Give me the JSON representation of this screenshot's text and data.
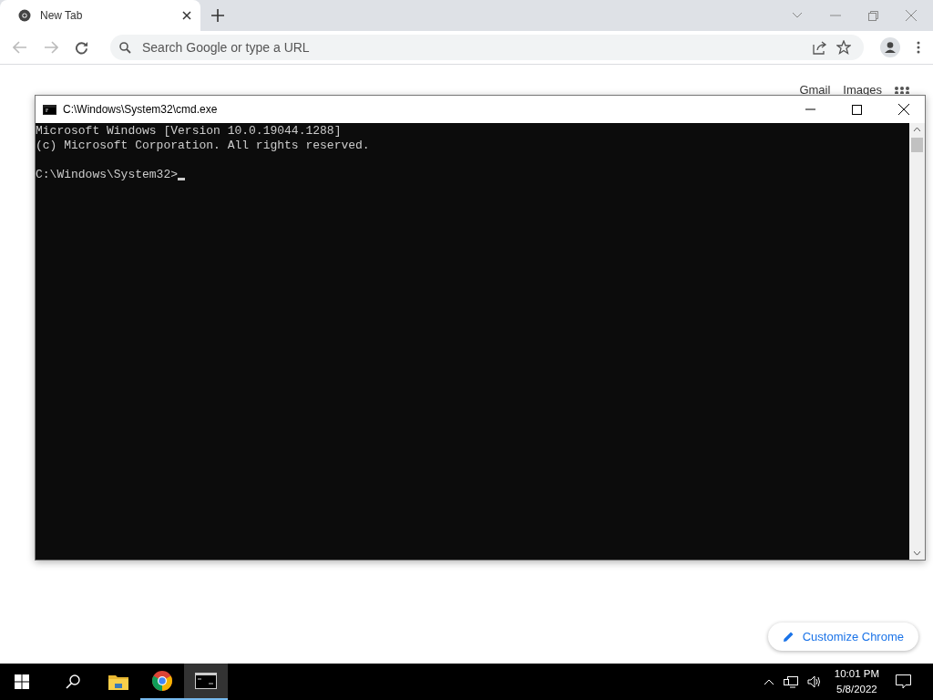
{
  "browser": {
    "tabs": [
      {
        "title": "New Tab",
        "selected": true
      }
    ],
    "omnibox": {
      "placeholder": "Search Google or type a URL"
    },
    "links": [
      "Gmail",
      "Images"
    ],
    "customize_button": "Customize Chrome"
  },
  "cmd_window": {
    "title": "C:\\Windows\\System32\\cmd.exe",
    "output": [
      "Microsoft Windows [Version 10.0.19044.1288]",
      "(c) Microsoft Corporation. All rights reserved."
    ],
    "prompt": "C:\\Windows\\System32>"
  },
  "taskbar": {
    "apps": [
      {
        "kind": "explorer",
        "running": false,
        "active": false
      },
      {
        "kind": "chrome",
        "running": true,
        "active": false
      },
      {
        "kind": "cmd",
        "running": true,
        "active": true
      }
    ],
    "time": "10:01 PM",
    "date": "5/8/2022"
  }
}
